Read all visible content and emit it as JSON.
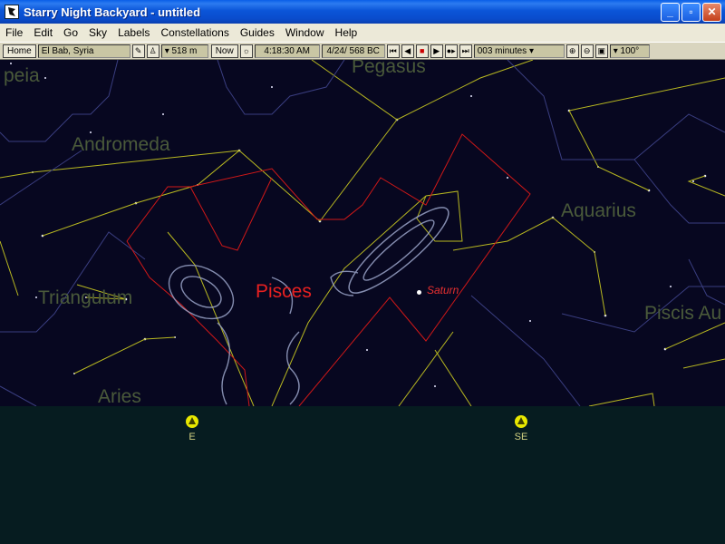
{
  "window": {
    "title": "Starry Night Backyard - untitled",
    "minimize": "_",
    "maximize": "▫",
    "close": "✕"
  },
  "menu": [
    "File",
    "Edit",
    "Go",
    "Sky",
    "Labels",
    "Constellations",
    "Guides",
    "Window",
    "Help"
  ],
  "toolbar": {
    "home_label": "Home",
    "location": "El Bab, Syria",
    "elevation": "▾ 518 m",
    "now_label": "Now",
    "time": "4:18:30 AM",
    "date": "4/24/  568 BC",
    "time_step": "003 minutes ▾",
    "fov": "▾ 100°"
  },
  "sky": {
    "constellation_labels": [
      "Pegasus",
      "Andromeda",
      "Aquarius",
      "Triangulum",
      "Aries",
      "Piscis Au",
      "peia"
    ],
    "highlight_constellation": "Pisces",
    "planet": "Saturn",
    "colors": {
      "background": "#070720",
      "constellation_line": "#c8c830",
      "boundary": "#d01818",
      "label": "#4a5a3a"
    }
  },
  "ground": {
    "markers": [
      {
        "name": "east",
        "label": "E"
      },
      {
        "name": "southeast",
        "label": "SE"
      }
    ],
    "color": "#061c20"
  }
}
